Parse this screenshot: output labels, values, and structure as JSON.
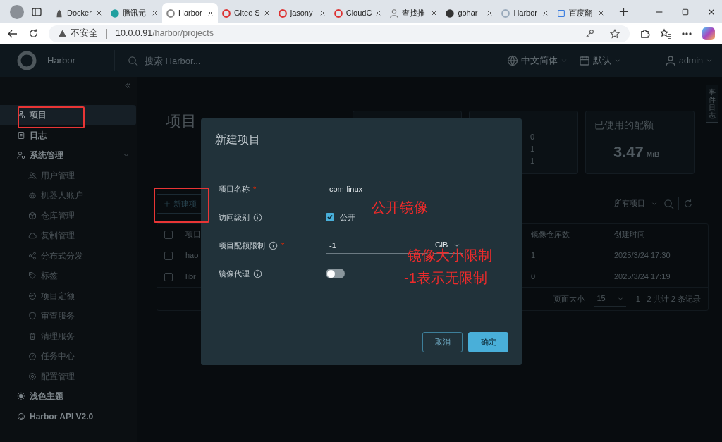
{
  "browser": {
    "tabs": [
      {
        "label": "Docker",
        "selected": false
      },
      {
        "label": "腾讯元",
        "selected": false
      },
      {
        "label": "Harbor",
        "selected": true
      },
      {
        "label": "Gitee S",
        "selected": false
      },
      {
        "label": "jasony",
        "selected": false
      },
      {
        "label": "CloudC",
        "selected": false
      },
      {
        "label": "查找推",
        "selected": false
      },
      {
        "label": "gohar",
        "selected": false
      },
      {
        "label": "Harbor",
        "selected": false
      },
      {
        "label": "百度翻",
        "selected": false
      }
    ],
    "address": {
      "security": "不安全",
      "host": "10.0.0.91",
      "path": "/harbor/projects"
    }
  },
  "header": {
    "brand": "Harbor",
    "search": {
      "placeholder": "搜索 Harbor..."
    },
    "language": "中文简体",
    "theme_menu": "默认",
    "user": "admin"
  },
  "sidebar": {
    "items": [
      {
        "label": "项目",
        "selected": true
      },
      {
        "label": "日志",
        "selected": false
      },
      {
        "label": "系统管理",
        "selected": false,
        "expanded": true,
        "children": [
          {
            "label": "用户管理",
            "selected": false
          },
          {
            "label": "机器人账户",
            "selected": false
          },
          {
            "label": "仓库管理",
            "selected": false
          },
          {
            "label": "复制管理",
            "selected": false
          },
          {
            "label": "分布式分发",
            "selected": false
          },
          {
            "label": "标签",
            "selected": false
          },
          {
            "label": "项目定额",
            "selected": false
          },
          {
            "label": "审查服务",
            "selected": false
          },
          {
            "label": "清理服务",
            "selected": false
          },
          {
            "label": "任务中心",
            "selected": false
          },
          {
            "label": "配置管理",
            "selected": false
          }
        ]
      },
      {
        "label": "浅色主题",
        "selected": false
      },
      {
        "label": "Harbor API V2.0",
        "selected": false
      }
    ]
  },
  "page": {
    "title": "项目",
    "summary_cards": [
      {
        "values": [
          "0",
          "1",
          "1"
        ]
      },
      {
        "label": "已使用的配额",
        "value": "3.47",
        "unit": "MiB"
      }
    ],
    "event_log_tab": "事件日志",
    "new_project_button": "新建项",
    "filter": "所有项目",
    "table": {
      "all_selected": false,
      "columns": [
        "项目",
        "镜像仓库数",
        "创建时间"
      ],
      "rows": [
        {
          "name": "hao",
          "repo_count": "1",
          "created": "2025/3/24 17:30",
          "selected": false
        },
        {
          "name": "libr",
          "repo_count": "0",
          "created": "2025/3/24 17:19",
          "selected": false
        }
      ]
    },
    "pagination": {
      "page_size_label": "页面大小",
      "page_size": "15",
      "summary": "1 - 2 共计 2 条记录"
    }
  },
  "dialog": {
    "title": "新建项目",
    "fields": [
      {
        "kind": "text",
        "label": "项目名称",
        "info": false,
        "required_mark": "*",
        "value": "com-linux"
      },
      {
        "kind": "checkbox",
        "label": "访问级别",
        "info": true,
        "option": "公开",
        "checked": true
      },
      {
        "kind": "quota",
        "label": "项目配额限制",
        "info": true,
        "required_mark": "*",
        "value": "-1",
        "unit": "GiB"
      },
      {
        "kind": "toggle",
        "label": "镜像代理",
        "info": true,
        "on": false
      }
    ],
    "buttons": [
      {
        "label": "取消",
        "kind": "secondary"
      },
      {
        "label": "确定",
        "kind": "primary"
      }
    ]
  },
  "annotations": [
    {
      "text": "公开镜像"
    },
    {
      "text": "镜像大小限制"
    },
    {
      "text": "-1表示无限制"
    }
  ]
}
